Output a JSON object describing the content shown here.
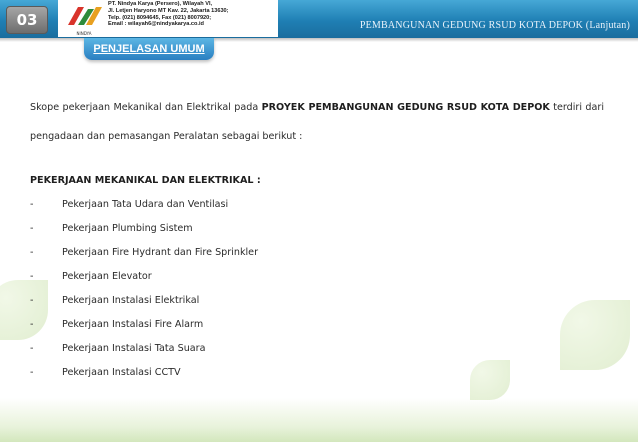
{
  "header": {
    "page_number": "03",
    "section_title": "PEMBANGUNAN GEDUNG RSUD KOTA DEPOK (Lanjutan)",
    "accent_color": "#2a7fc1"
  },
  "company": {
    "logo_caption": "NINDYA",
    "lines": [
      "PT. Nindya Karya (Persero), Wilayah VI,",
      "Jl. Letjen Haryono MT Kav. 22, Jakarta 13630;",
      "Telp. (021) 8094645, Fax (021) 8007920;",
      "Email : wilayah6@nindyakarya.co.id"
    ]
  },
  "tab": {
    "title": "PENJELASAN UMUM"
  },
  "content": {
    "intro_prefix": "Skope pekerjaan Mekanikal dan Elektrikal pada ",
    "intro_strong": "PROYEK PEMBANGUNAN GEDUNG RSUD KOTA DEPOK",
    "intro_suffix": " terdiri  dari pengadaan dan pemasangan Peralatan sebagai berikut :",
    "section_heading": "PEKERJAAN MEKANIKAL DAN ELEKTRIKAL   :",
    "bullet": "-",
    "items": [
      "Pekerjaan Tata Udara dan Ventilasi",
      "Pekerjaan Plumbing Sistem",
      "Pekerjaan Fire Hydrant dan Fire Sprinkler",
      "Pekerjaan Elevator",
      "Pekerjaan Instalasi Elektrikal",
      "Pekerjaan Instalasi Fire Alarm",
      "Pekerjaan Instalasi Tata Suara",
      "Pekerjaan Instalasi CCTV"
    ]
  }
}
